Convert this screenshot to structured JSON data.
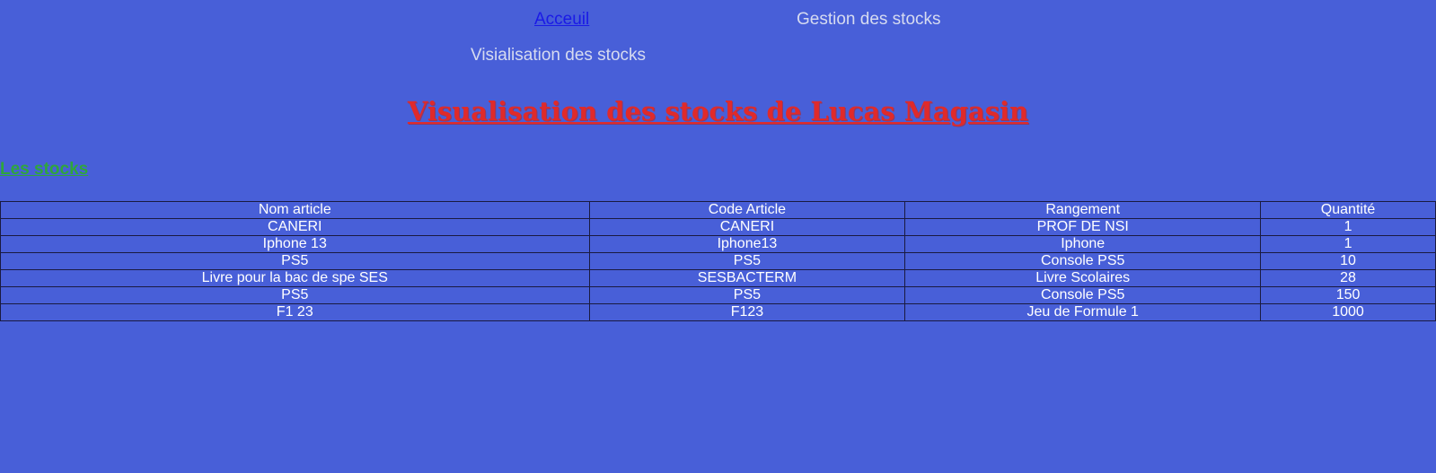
{
  "nav": {
    "accueil": "Acceuil",
    "gestion": "Gestion des stocks",
    "visualisation": "Visialisation des stocks"
  },
  "page_title": "Visualisation des stocks de Lucas Magasin",
  "section_title": "Les stocks",
  "table": {
    "headers": [
      "Nom article",
      "Code Article",
      "Rangement",
      "Quantité"
    ],
    "rows": [
      [
        "CANERI",
        "CANERI",
        "PROF DE NSI",
        "1"
      ],
      [
        "Iphone 13",
        "Iphone13",
        "Iphone",
        "1"
      ],
      [
        "PS5",
        "PS5",
        "Console PS5",
        "10"
      ],
      [
        "Livre pour la bac de spe SES",
        "SESBACTERM",
        "Livre Scolaires",
        "28"
      ],
      [
        "PS5",
        "PS5",
        "Console PS5",
        "150"
      ],
      [
        "F1 23",
        "F123",
        "Jeu de Formule 1",
        "1000"
      ]
    ]
  },
  "colors": {
    "background": "#485fd8",
    "link": "#1a1ae6",
    "nav_text": "#d6dbf0",
    "title": "#e02a2a",
    "section_title": "#2fa63c",
    "table_text": "#ffffff"
  }
}
